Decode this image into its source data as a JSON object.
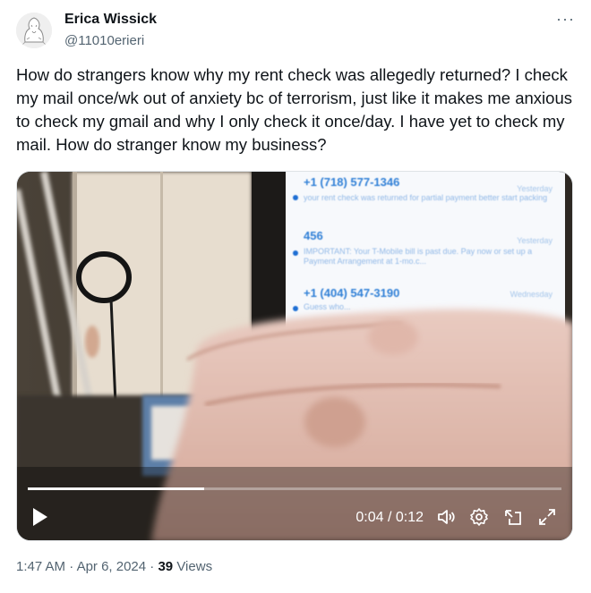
{
  "author": {
    "name": "Erica Wissick",
    "handle": "@11010erieri"
  },
  "post": {
    "text": "How do strangers know why my rent check was allegedly returned? I check my mail once/wk out of anxiety bc of terrorism, just like it makes me anxious to check my gmail and why I only check it once/day. I have yet to check my mail. How do stranger know my business?",
    "more_label": "···"
  },
  "video": {
    "time_display": "0:04 / 0:12",
    "progress": 0.33,
    "phone_screen": [
      {
        "sender": "+1 (718) 577-1346",
        "date": "Yesterday",
        "preview": "your rent check was returned for partial payment better start packing"
      },
      {
        "sender": "456",
        "date": "Yesterday",
        "preview": "IMPORTANT: Your T-Mobile bill is past due. Pay now or set up a Payment Arrangement at 1-mo.c..."
      },
      {
        "sender": "+1 (404) 547-3190",
        "date": "Wednesday",
        "preview": "Guess who..."
      }
    ]
  },
  "meta": {
    "time": "1:47 AM",
    "sep1": "·",
    "date": "Apr 6, 2024",
    "sep2": "·",
    "views_count": "39",
    "views_label": "Views"
  },
  "colors": {
    "text_primary": "#0f1419",
    "text_secondary": "#536471",
    "phone_accent": "#1f6fd4"
  },
  "icons": [
    "avatar-drawing",
    "more-icon",
    "play-icon",
    "volume-icon",
    "settings-icon",
    "pip-icon",
    "fullscreen-icon"
  ]
}
